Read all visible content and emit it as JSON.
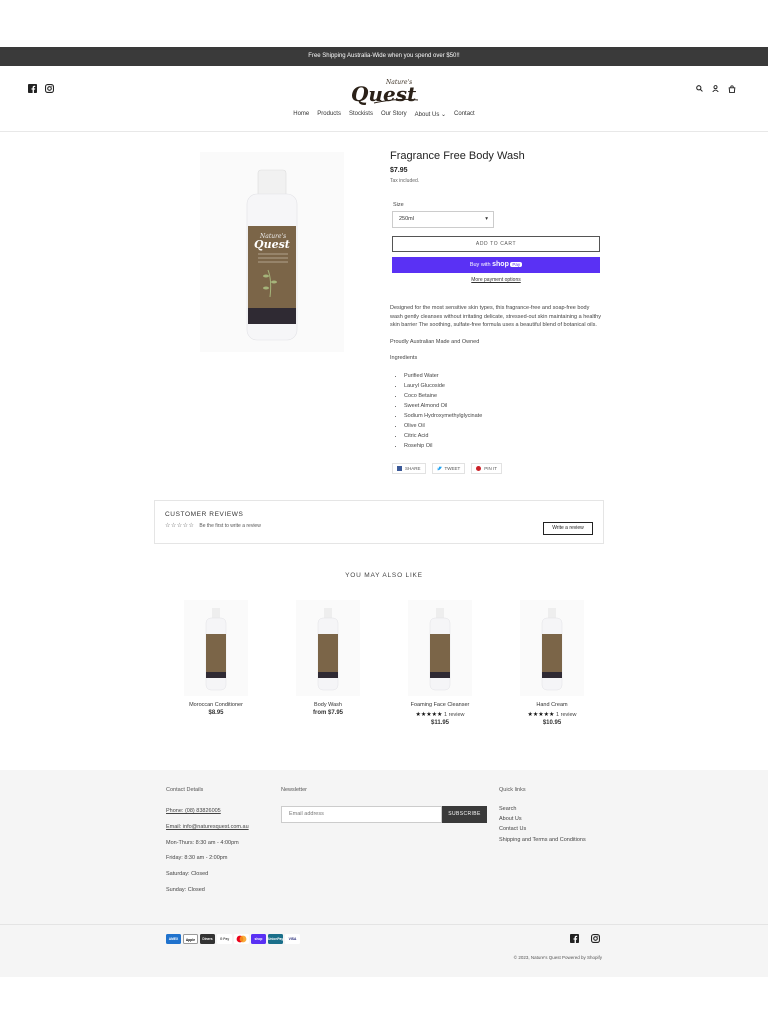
{
  "announcement": "Free Shipping Australia-Wide when you spend over $50!!",
  "header": {
    "logo_text_top": "Nature's",
    "logo_text_main": "Quest",
    "nav": [
      "Home",
      "Products",
      "Stockists",
      "Our Story",
      "About Us",
      "Contact"
    ]
  },
  "product": {
    "title": "Fragrance Free Body Wash",
    "price": "$7.95",
    "tax_note": "Tax included.",
    "size_label": "Size",
    "size_value": "250ml",
    "add_to_cart": "ADD TO CART",
    "buy_with": "Buy with",
    "shop_pay": "shop",
    "shop_pay_badge": "Pay",
    "more_payment": "More payment options",
    "desc_1": "Designed for the most sensitive skin types, this fragrance-free and soap-free body wash gently cleanses without irritating delicate, stressed-out skin maintaining a healthy skin barrier The soothing, sulfate-free formula uses a beautiful blend of botanical oils.",
    "desc_2": "Proudly Australian Made and Owned",
    "ingredients_heading": "Ingredients",
    "ingredients": [
      "Purified Water",
      "Lauryl Glucoside",
      "Coco Betaine",
      "Sweet Almond Oil",
      "Sodium Hydroxymethylglycinate",
      "Olive Oil",
      "Citric Acid",
      "Rosehip Oil"
    ],
    "share": [
      "SHARE",
      "TWEET",
      "PIN IT"
    ]
  },
  "reviews": {
    "title": "CUSTOMER REVIEWS",
    "first": "Be the first to write a review",
    "write": "Write a review"
  },
  "related_heading": "YOU MAY ALSO LIKE",
  "related": [
    {
      "name": "Moroccan Conditioner",
      "price": "$8.95",
      "stars": "",
      "reviews": ""
    },
    {
      "name": "Body Wash",
      "price": "from $7.95",
      "stars": "",
      "reviews": ""
    },
    {
      "name": "Foaming Face Cleanser",
      "price": "$11.95",
      "stars": "★★★★★",
      "reviews": "1 review"
    },
    {
      "name": "Hand Cream",
      "price": "$10.95",
      "stars": "★★★★★",
      "reviews": "1 review"
    }
  ],
  "footer": {
    "contact_heading": "Contact Details",
    "phone": "Phone:  (08) 83826005",
    "email": "Email:  info@naturesquest.com.au",
    "hours_1": "Mon-Thurs: 8:30 am - 4:00pm",
    "hours_2": "Friday: 8:30 am - 2:00pm",
    "hours_3": "Saturday: Closed",
    "hours_4": "Sunday: Closed",
    "newsletter_heading": "Newsletter",
    "email_placeholder": "Email address",
    "subscribe": "SUBSCRIBE",
    "quick_heading": "Quick links",
    "quick_links": [
      "Search",
      "About Us",
      "Contact Us",
      "Shipping and Terms and Conditions"
    ],
    "payments": [
      "AMEX",
      "Apple Pay",
      "Diners",
      "G Pay",
      "Master",
      "shop",
      "UnionPay",
      "VISA"
    ],
    "copyright": "© 2023, Nature's Quest Powered by Shopify"
  },
  "colors": {
    "announce_bg": "#3a3a3a",
    "shop_pay": "#5a31f4",
    "bottle_label": "#7b6548"
  }
}
